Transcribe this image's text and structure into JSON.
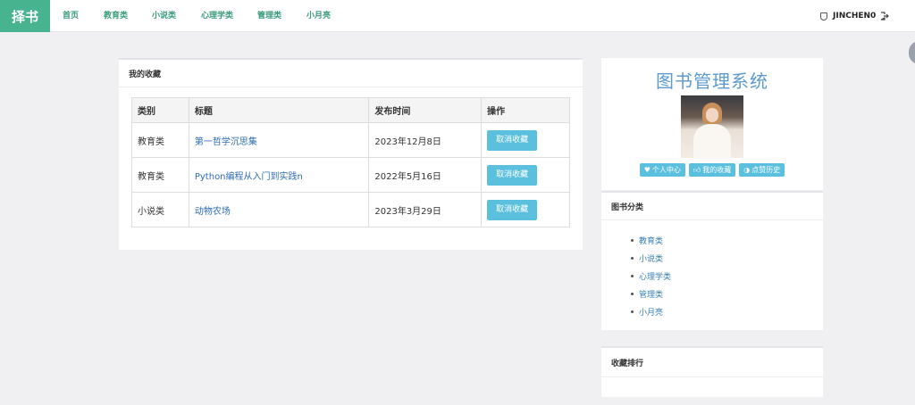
{
  "navbar": {
    "brand": "择书",
    "items": [
      "首页",
      "教育类",
      "小说类",
      "心理学类",
      "管理类",
      "小月亮"
    ],
    "username": "JINCHEN0"
  },
  "favorites": {
    "title": "我的收藏",
    "columns": [
      "类别",
      "标题",
      "发布时间",
      "操作"
    ],
    "rows": [
      {
        "category": "教育类",
        "title": "第一哲学沉思集",
        "date": "2023年12月8日",
        "action": "取消收藏"
      },
      {
        "category": "教育类",
        "title": "Python编程从入门到实践n",
        "date": "2022年5月16日",
        "action": "取消收藏"
      },
      {
        "category": "小说类",
        "title": "动物农场",
        "date": "2023年3月29日",
        "action": "取消收藏"
      }
    ]
  },
  "profile": {
    "system_title": "图书管理系统",
    "buttons": [
      {
        "label": "个人中心",
        "icon": "heart-icon"
      },
      {
        "label": "我的收藏",
        "icon": "thumbs-up-icon"
      },
      {
        "label": "点赞历史",
        "icon": "half-circle-icon"
      }
    ]
  },
  "categories": {
    "title": "图书分类",
    "items": [
      "教育类",
      "小说类",
      "心理学类",
      "管理类",
      "小月亮"
    ]
  },
  "ranking": {
    "title": "收藏排行"
  }
}
